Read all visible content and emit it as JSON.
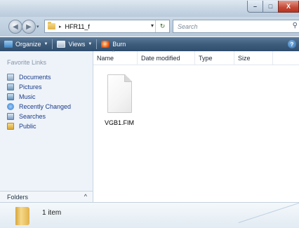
{
  "window": {
    "caption_buttons": {
      "minimize_glyph": "–",
      "maximize_glyph": "□",
      "close_glyph": "X"
    }
  },
  "address_bar": {
    "separator": "▸",
    "path": "HFR11_f",
    "dropdown_glyph": "▾",
    "refresh_glyph": "↻"
  },
  "search": {
    "placeholder": "Search",
    "icon": "search-icon"
  },
  "navigation_buttons": {
    "back_glyph": "◀",
    "forward_glyph": "▶",
    "history_glyph": "▾"
  },
  "command_bar": {
    "items": [
      {
        "label": "Organize",
        "icon": "organize-icon"
      },
      {
        "label": "Views",
        "icon": "views-icon"
      },
      {
        "label": "Burn",
        "icon": "burn-icon"
      }
    ],
    "caret": "▼",
    "help_glyph": "?"
  },
  "nav_pane": {
    "header": "Favorite Links",
    "items": [
      {
        "label": "Documents",
        "icon": "documents-icon"
      },
      {
        "label": "Pictures",
        "icon": "pictures-icon"
      },
      {
        "label": "Music",
        "icon": "music-icon"
      },
      {
        "label": "Recently Changed",
        "icon": "recently-changed-icon"
      },
      {
        "label": "Searches",
        "icon": "searches-icon"
      },
      {
        "label": "Public",
        "icon": "public-folder-icon"
      }
    ],
    "folders_label": "Folders",
    "folders_chevron": "^"
  },
  "columns": {
    "name": "Name",
    "date_modified": "Date modified",
    "type": "Type",
    "size": "Size",
    "sort_glyph": "^"
  },
  "files": [
    {
      "name": "VGB1.FIM",
      "icon": "generic-file-icon"
    }
  ],
  "details_pane": {
    "item_count": "1 item"
  },
  "colors": {
    "command_bar": "#3e5c7c",
    "nav_pane_bg": "#eef3f9",
    "nav_link": "#1a3c8a",
    "close_button": "#c44a36"
  }
}
